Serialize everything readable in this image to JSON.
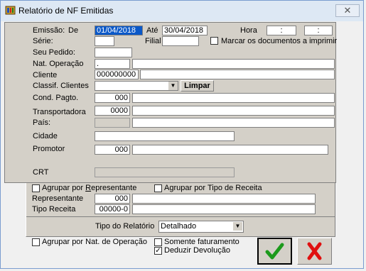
{
  "window": {
    "title": "Relatório de NF Emitidas",
    "close_glyph": "✕"
  },
  "emissao": {
    "label": "Emissão:",
    "de_label": "De",
    "de_value": "01/04/2018",
    "ate_label": "Até",
    "ate_value": "30/04/2018",
    "hora_label": "Hora",
    "hora_de": ":",
    "hora_ate": ":"
  },
  "serie": {
    "label": "Série:",
    "value": ""
  },
  "filial": {
    "label": "Filial",
    "value": ""
  },
  "marcar": {
    "label": "Marcar os documentos a imprimir",
    "checked": false
  },
  "pedido": {
    "label": "Seu Pedido:",
    "value": ""
  },
  "nat_operacao": {
    "label": "Nat. Operação",
    "code": ".",
    "desc": ""
  },
  "cliente": {
    "label": "Cliente",
    "code": "000000000",
    "desc": ""
  },
  "classif": {
    "label": "Classif. Clientes",
    "value": "",
    "limpar_label": "Limpar"
  },
  "cond_pagto": {
    "label": "Cond. Pagto.",
    "code": "000",
    "desc": ""
  },
  "transportadora": {
    "label": "Transportadora",
    "code": "0000",
    "desc": ""
  },
  "pais": {
    "label": "País:",
    "code": "",
    "desc": ""
  },
  "cidade": {
    "label": "Cidade",
    "value": ""
  },
  "promotor": {
    "label": "Promotor",
    "code": "000",
    "desc": ""
  },
  "crt": {
    "label": "CRT",
    "value": ""
  },
  "agrupar_rep": {
    "label_pre": "Agrupar por ",
    "label_u": "R",
    "label_post": "epresentante",
    "checked": false
  },
  "agrupar_receita": {
    "label": "Agrupar por Tipo de Receita",
    "checked": false
  },
  "representante": {
    "label": "Representante",
    "code": "000",
    "desc": ""
  },
  "tipo_receita": {
    "label": "Tipo Receita",
    "code": "00000-0",
    "desc": ""
  },
  "tipo_relatorio": {
    "label": "Tipo do Relatório",
    "value": "Detalhado"
  },
  "agrupar_nat": {
    "label": "Agrupar por Nat. de Operação",
    "checked": false
  },
  "somente_fat": {
    "label": "Somente faturamento",
    "checked": false
  },
  "deduzir_dev": {
    "label": "Deduzir Devolução",
    "checked": true
  },
  "buttons": {
    "ok_glyph": "✔",
    "cancel_glyph": "✘"
  },
  "colors": {
    "ok": "#1c9a1c",
    "cancel": "#e01010",
    "selection": "#0a58c8"
  }
}
